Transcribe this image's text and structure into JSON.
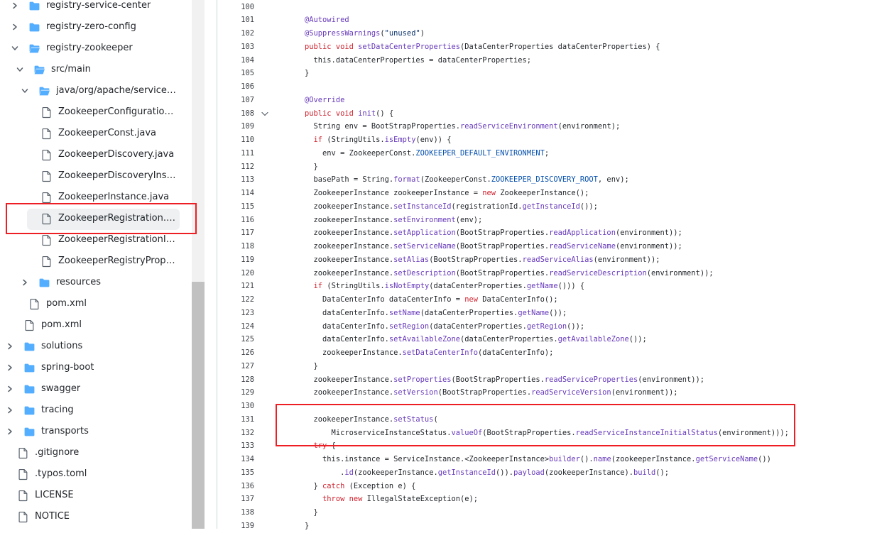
{
  "colors": {
    "folder": "#54aeff",
    "highlight_box": "#ee1f24",
    "selected_bg": "#eef0f2",
    "keyword": "#cf222e",
    "function": "#6639ba",
    "constant": "#0550ae",
    "string": "#0a3069"
  },
  "file_tree": [
    {
      "label": "registry-service-center",
      "type": "folder",
      "state": "collapsed",
      "icon": "folder-icon"
    },
    {
      "label": "registry-zero-config",
      "type": "folder",
      "state": "collapsed",
      "icon": "folder-icon"
    },
    {
      "label": "registry-zookeeper",
      "type": "folder",
      "state": "expanded",
      "icon": "folder-open-icon"
    },
    {
      "label": "src/main",
      "type": "folder",
      "state": "expanded",
      "icon": "folder-open-icon"
    },
    {
      "label": "java/org/apache/servicecom...",
      "type": "folder",
      "state": "expanded",
      "icon": "folder-open-icon"
    },
    {
      "label": "ZookeeperConfiguration.ja...",
      "type": "file",
      "icon": "file-icon"
    },
    {
      "label": "ZookeeperConst.java",
      "type": "file",
      "icon": "file-icon"
    },
    {
      "label": "ZookeeperDiscovery.java",
      "type": "file",
      "icon": "file-icon"
    },
    {
      "label": "ZookeeperDiscoveryInstan...",
      "type": "file",
      "icon": "file-icon"
    },
    {
      "label": "ZookeeperInstance.java",
      "type": "file",
      "icon": "file-icon"
    },
    {
      "label": "ZookeeperRegistration.java",
      "type": "file",
      "icon": "file-icon",
      "selected": true
    },
    {
      "label": "ZookeeperRegistrationInst...",
      "type": "file",
      "icon": "file-icon"
    },
    {
      "label": "ZookeeperRegistryProperti...",
      "type": "file",
      "icon": "file-icon"
    },
    {
      "label": "resources",
      "type": "folder",
      "state": "collapsed",
      "icon": "folder-icon"
    },
    {
      "label": "pom.xml",
      "type": "file",
      "icon": "file-icon"
    },
    {
      "label": "pom.xml",
      "type": "file",
      "icon": "file-icon"
    },
    {
      "label": "solutions",
      "type": "folder",
      "state": "collapsed",
      "icon": "folder-icon"
    },
    {
      "label": "spring-boot",
      "type": "folder",
      "state": "collapsed",
      "icon": "folder-icon"
    },
    {
      "label": "swagger",
      "type": "folder",
      "state": "collapsed",
      "icon": "folder-icon"
    },
    {
      "label": "tracing",
      "type": "folder",
      "state": "collapsed",
      "icon": "folder-icon"
    },
    {
      "label": "transports",
      "type": "folder",
      "state": "collapsed",
      "icon": "folder-icon"
    },
    {
      "label": ".gitignore",
      "type": "file",
      "icon": "file-icon"
    },
    {
      "label": ".typos.toml",
      "type": "file",
      "icon": "file-icon"
    },
    {
      "label": "LICENSE",
      "type": "file",
      "icon": "file-icon"
    },
    {
      "label": "NOTICE",
      "type": "file",
      "icon": "file-icon"
    }
  ],
  "code_lines": [
    {
      "n": "100",
      "t": []
    },
    {
      "n": "101",
      "t": [
        [
          "    ",
          ""
        ],
        [
          "@Autowired",
          "ann"
        ]
      ]
    },
    {
      "n": "102",
      "t": [
        [
          "    ",
          ""
        ],
        [
          "@SuppressWarnings",
          "ann"
        ],
        [
          "(",
          ""
        ],
        [
          "\"unused\"",
          "str"
        ],
        [
          ")",
          ""
        ]
      ]
    },
    {
      "n": "103",
      "t": [
        [
          "    ",
          ""
        ],
        [
          "public",
          "kw"
        ],
        [
          " ",
          ""
        ],
        [
          "void",
          "kw"
        ],
        [
          " ",
          ""
        ],
        [
          "setDataCenterProperties",
          "fn"
        ],
        [
          "(DataCenterProperties dataCenterProperties) {",
          ""
        ]
      ]
    },
    {
      "n": "104",
      "t": [
        [
          "      this.dataCenterProperties = dataCenterProperties;",
          ""
        ]
      ]
    },
    {
      "n": "105",
      "t": [
        [
          "    }",
          ""
        ]
      ]
    },
    {
      "n": "106",
      "t": []
    },
    {
      "n": "107",
      "t": [
        [
          "    ",
          ""
        ],
        [
          "@Override",
          "ann"
        ]
      ]
    },
    {
      "n": "108",
      "fold": true,
      "t": [
        [
          "    ",
          ""
        ],
        [
          "public",
          "kw"
        ],
        [
          " ",
          ""
        ],
        [
          "void",
          "kw"
        ],
        [
          " ",
          ""
        ],
        [
          "init",
          "fn"
        ],
        [
          "() {",
          ""
        ]
      ]
    },
    {
      "n": "109",
      "t": [
        [
          "      String env = BootStrapProperties.",
          ""
        ],
        [
          "readServiceEnvironment",
          "fn"
        ],
        [
          "(environment);",
          ""
        ]
      ]
    },
    {
      "n": "110",
      "t": [
        [
          "      ",
          ""
        ],
        [
          "if",
          "kw"
        ],
        [
          " (StringUtils.",
          ""
        ],
        [
          "isEmpty",
          "fn"
        ],
        [
          "(env)) {",
          ""
        ]
      ]
    },
    {
      "n": "111",
      "t": [
        [
          "        env = ZookeeperConst.",
          ""
        ],
        [
          "ZOOKEEPER_DEFAULT_ENVIRONMENT",
          "const"
        ],
        [
          ";",
          ""
        ]
      ]
    },
    {
      "n": "112",
      "t": [
        [
          "      }",
          ""
        ]
      ]
    },
    {
      "n": "113",
      "t": [
        [
          "      basePath = String.",
          ""
        ],
        [
          "format",
          "fn"
        ],
        [
          "(ZookeeperConst.",
          ""
        ],
        [
          "ZOOKEEPER_DISCOVERY_ROOT",
          "const"
        ],
        [
          ", env);",
          ""
        ]
      ]
    },
    {
      "n": "114",
      "t": [
        [
          "      ZookeeperInstance zookeeperInstance = ",
          ""
        ],
        [
          "new",
          "kw"
        ],
        [
          " ZookeeperInstance();",
          ""
        ]
      ]
    },
    {
      "n": "115",
      "t": [
        [
          "      zookeeperInstance.",
          ""
        ],
        [
          "setInstanceId",
          "fn"
        ],
        [
          "(registrationId.",
          ""
        ],
        [
          "getInstanceId",
          "fn"
        ],
        [
          "());",
          ""
        ]
      ]
    },
    {
      "n": "116",
      "t": [
        [
          "      zookeeperInstance.",
          ""
        ],
        [
          "setEnvironment",
          "fn"
        ],
        [
          "(env);",
          ""
        ]
      ]
    },
    {
      "n": "117",
      "t": [
        [
          "      zookeeperInstance.",
          ""
        ],
        [
          "setApplication",
          "fn"
        ],
        [
          "(BootStrapProperties.",
          ""
        ],
        [
          "readApplication",
          "fn"
        ],
        [
          "(environment));",
          ""
        ]
      ]
    },
    {
      "n": "118",
      "t": [
        [
          "      zookeeperInstance.",
          ""
        ],
        [
          "setServiceName",
          "fn"
        ],
        [
          "(BootStrapProperties.",
          ""
        ],
        [
          "readServiceName",
          "fn"
        ],
        [
          "(environment));",
          ""
        ]
      ]
    },
    {
      "n": "119",
      "t": [
        [
          "      zookeeperInstance.",
          ""
        ],
        [
          "setAlias",
          "fn"
        ],
        [
          "(BootStrapProperties.",
          ""
        ],
        [
          "readServiceAlias",
          "fn"
        ],
        [
          "(environment));",
          ""
        ]
      ]
    },
    {
      "n": "120",
      "t": [
        [
          "      zookeeperInstance.",
          ""
        ],
        [
          "setDescription",
          "fn"
        ],
        [
          "(BootStrapProperties.",
          ""
        ],
        [
          "readServiceDescription",
          "fn"
        ],
        [
          "(environment));",
          ""
        ]
      ]
    },
    {
      "n": "121",
      "t": [
        [
          "      ",
          ""
        ],
        [
          "if",
          "kw"
        ],
        [
          " (StringUtils.",
          ""
        ],
        [
          "isNotEmpty",
          "fn"
        ],
        [
          "(dataCenterProperties.",
          ""
        ],
        [
          "getName",
          "fn"
        ],
        [
          "())) {",
          ""
        ]
      ]
    },
    {
      "n": "122",
      "t": [
        [
          "        DataCenterInfo dataCenterInfo = ",
          ""
        ],
        [
          "new",
          "kw"
        ],
        [
          " DataCenterInfo();",
          ""
        ]
      ]
    },
    {
      "n": "123",
      "t": [
        [
          "        dataCenterInfo.",
          ""
        ],
        [
          "setName",
          "fn"
        ],
        [
          "(dataCenterProperties.",
          ""
        ],
        [
          "getName",
          "fn"
        ],
        [
          "());",
          ""
        ]
      ]
    },
    {
      "n": "124",
      "t": [
        [
          "        dataCenterInfo.",
          ""
        ],
        [
          "setRegion",
          "fn"
        ],
        [
          "(dataCenterProperties.",
          ""
        ],
        [
          "getRegion",
          "fn"
        ],
        [
          "());",
          ""
        ]
      ]
    },
    {
      "n": "125",
      "t": [
        [
          "        dataCenterInfo.",
          ""
        ],
        [
          "setAvailableZone",
          "fn"
        ],
        [
          "(dataCenterProperties.",
          ""
        ],
        [
          "getAvailableZone",
          "fn"
        ],
        [
          "());",
          ""
        ]
      ]
    },
    {
      "n": "126",
      "t": [
        [
          "        zookeeperInstance.",
          ""
        ],
        [
          "setDataCenterInfo",
          "fn"
        ],
        [
          "(dataCenterInfo);",
          ""
        ]
      ]
    },
    {
      "n": "127",
      "t": [
        [
          "      }",
          ""
        ]
      ]
    },
    {
      "n": "128",
      "t": [
        [
          "      zookeeperInstance.",
          ""
        ],
        [
          "setProperties",
          "fn"
        ],
        [
          "(BootStrapProperties.",
          ""
        ],
        [
          "readServiceProperties",
          "fn"
        ],
        [
          "(environment));",
          ""
        ]
      ]
    },
    {
      "n": "129",
      "t": [
        [
          "      zookeeperInstance.",
          ""
        ],
        [
          "setVersion",
          "fn"
        ],
        [
          "(BootStrapProperties.",
          ""
        ],
        [
          "readServiceVersion",
          "fn"
        ],
        [
          "(environment));",
          ""
        ]
      ]
    },
    {
      "n": "130",
      "t": []
    },
    {
      "n": "131",
      "t": [
        [
          "      zookeeperInstance.",
          ""
        ],
        [
          "setStatus",
          "fn"
        ],
        [
          "(",
          ""
        ]
      ]
    },
    {
      "n": "132",
      "t": [
        [
          "          MicroserviceInstanceStatus.",
          ""
        ],
        [
          "valueOf",
          "fn"
        ],
        [
          "(BootStrapProperties.",
          ""
        ],
        [
          "readServiceInstanceInitialStatus",
          "fn"
        ],
        [
          "(environment)));",
          ""
        ]
      ]
    },
    {
      "n": "133",
      "t": [
        [
          "      ",
          ""
        ],
        [
          "try",
          "kw"
        ],
        [
          " {",
          ""
        ]
      ]
    },
    {
      "n": "134",
      "t": [
        [
          "        this.instance = ServiceInstance.<ZookeeperInstance>",
          ""
        ],
        [
          "builder",
          "fn"
        ],
        [
          "().",
          ""
        ],
        [
          "name",
          "fn"
        ],
        [
          "(zookeeperInstance.",
          ""
        ],
        [
          "getServiceName",
          "fn"
        ],
        [
          "())",
          ""
        ]
      ]
    },
    {
      "n": "135",
      "t": [
        [
          "            .",
          ""
        ],
        [
          "id",
          "fn"
        ],
        [
          "(zookeeperInstance.",
          ""
        ],
        [
          "getInstanceId",
          "fn"
        ],
        [
          "()).",
          ""
        ],
        [
          "payload",
          "fn"
        ],
        [
          "(zookeeperInstance).",
          ""
        ],
        [
          "build",
          "fn"
        ],
        [
          "();",
          ""
        ]
      ]
    },
    {
      "n": "136",
      "t": [
        [
          "      } ",
          ""
        ],
        [
          "catch",
          "kw"
        ],
        [
          " (Exception e) {",
          ""
        ]
      ]
    },
    {
      "n": "137",
      "t": [
        [
          "        ",
          ""
        ],
        [
          "throw",
          "kw"
        ],
        [
          " ",
          ""
        ],
        [
          "new",
          "kw"
        ],
        [
          " IllegalStateException(e);",
          ""
        ]
      ]
    },
    {
      "n": "138",
      "t": [
        [
          "      }",
          ""
        ]
      ]
    },
    {
      "n": "139",
      "t": [
        [
          "    }",
          ""
        ]
      ]
    }
  ]
}
